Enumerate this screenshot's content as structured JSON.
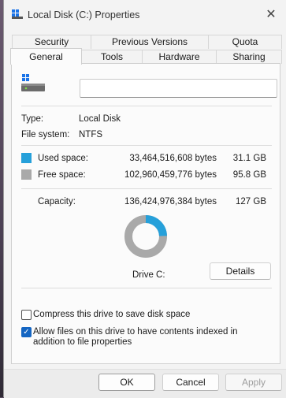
{
  "window": {
    "title": "Local Disk (C:) Properties",
    "close_icon": "close-icon"
  },
  "tabs": {
    "row1": [
      "Security",
      "Previous Versions",
      "Quota"
    ],
    "row2": [
      "General",
      "Tools",
      "Hardware",
      "Sharing"
    ],
    "active": "General"
  },
  "general": {
    "drive_name_value": "",
    "type_label": "Type:",
    "type_value": "Local Disk",
    "fs_label": "File system:",
    "fs_value": "NTFS",
    "used": {
      "label": "Used space:",
      "bytes": "33,464,516,608 bytes",
      "size": "31.1 GB",
      "color": "#26a0da"
    },
    "free": {
      "label": "Free space:",
      "bytes": "102,960,459,776 bytes",
      "size": "95.8 GB",
      "color": "#a9a9a9"
    },
    "capacity": {
      "label": "Capacity:",
      "bytes": "136,424,976,384 bytes",
      "size": "127 GB"
    },
    "drive_label": "Drive C:",
    "details_button": "Details",
    "usage_fraction_used": 0.245,
    "compress_label": "Compress this drive to save disk space",
    "compress_checked": false,
    "index_label": "Allow files on this drive to have contents indexed in addition to file properties",
    "index_checked": true
  },
  "footer": {
    "ok": "OK",
    "cancel": "Cancel",
    "apply": "Apply"
  }
}
